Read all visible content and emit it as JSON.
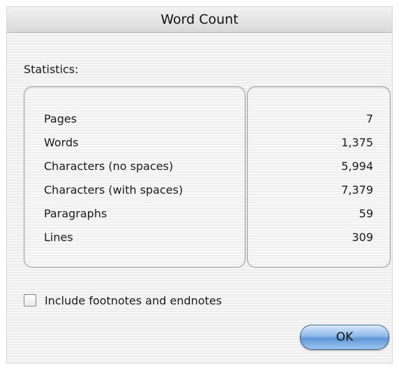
{
  "window": {
    "title": "Word Count"
  },
  "statistics": {
    "label": "Statistics:",
    "rows": [
      {
        "label": "Pages",
        "value": "7"
      },
      {
        "label": "Words",
        "value": "1,375"
      },
      {
        "label": "Characters (no spaces)",
        "value": "5,994"
      },
      {
        "label": "Characters (with spaces)",
        "value": "7,379"
      },
      {
        "label": "Paragraphs",
        "value": "59"
      },
      {
        "label": "Lines",
        "value": "309"
      }
    ]
  },
  "options": {
    "include_footnotes_label": "Include footnotes and endnotes",
    "include_footnotes_checked": false
  },
  "buttons": {
    "ok_label": "OK"
  },
  "colors": {
    "accent_button": "#8eb9ea",
    "panel_border": "#9a9a9a"
  }
}
